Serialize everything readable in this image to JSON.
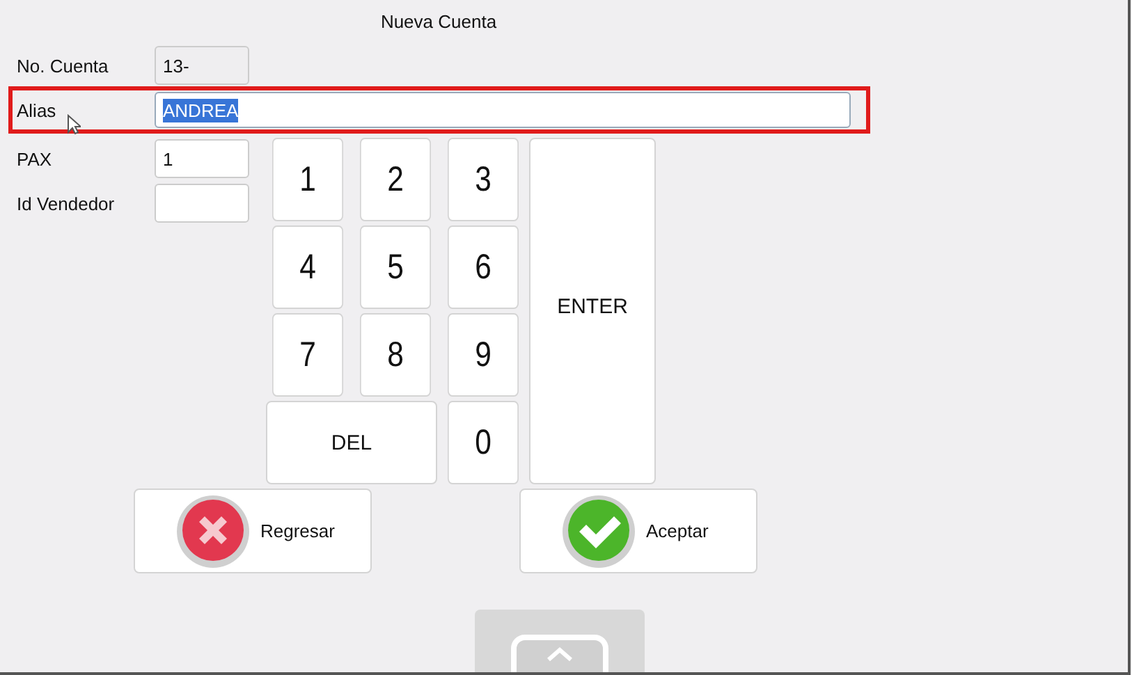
{
  "window": {
    "title": "Nueva Cuenta"
  },
  "fields": [
    {
      "label": "No. Cuenta",
      "value": "13-",
      "kind": "short",
      "readonly": true,
      "highlighted": false,
      "text_selected": false
    },
    {
      "label": "Alias",
      "value": "ANDREA",
      "kind": "wide",
      "readonly": false,
      "highlighted": true,
      "text_selected": true
    },
    {
      "label": "PAX",
      "value": "1",
      "kind": "short",
      "readonly": false,
      "highlighted": false,
      "text_selected": false
    },
    {
      "label": "Id Vendedor",
      "kind": "short",
      "readonly": false,
      "highlighted": false,
      "text_selected": false
    }
  ],
  "keypad": [
    {
      "key": "1",
      "kind": "digit"
    },
    {
      "key": "2",
      "kind": "digit"
    },
    {
      "key": "3",
      "kind": "digit"
    },
    {
      "key": "ENTER",
      "kind": "enter"
    },
    {
      "key": "4",
      "kind": "digit"
    },
    {
      "key": "5",
      "kind": "digit"
    },
    {
      "key": "6",
      "kind": "digit"
    },
    {
      "key": "7",
      "kind": "digit"
    },
    {
      "key": "8",
      "kind": "digit"
    },
    {
      "key": "9",
      "kind": "digit"
    },
    {
      "key": "DEL",
      "kind": "del"
    },
    {
      "key": "0",
      "kind": "digit"
    }
  ],
  "actions": [
    {
      "label": "Regresar",
      "kind": "cancel"
    },
    {
      "label": "Aceptar",
      "kind": "accept"
    }
  ]
}
